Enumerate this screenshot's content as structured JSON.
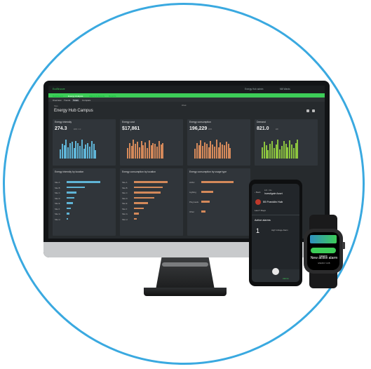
{
  "app": {
    "title": "EcoStruxure",
    "user": "Energy Hub admin",
    "site_selector": "Mill Wards"
  },
  "nav": {
    "tabs": [
      "Dashboard",
      "Energy Analysis",
      "Alarms & Events",
      "Reports"
    ],
    "active_tab": 1,
    "subtabs": [
      "Overview",
      "Trends",
      "Totals",
      "Compare"
    ]
  },
  "page": {
    "breadcrumb": "Sites",
    "title": "Energy Hub Campus",
    "period": "Week"
  },
  "cards": [
    {
      "title": "Energy intensity",
      "value": "274.3",
      "unit": "kWh / m²",
      "bar_color": "#5fb4d6",
      "bars": [
        0.45,
        0.7,
        0.62,
        0.9,
        0.55,
        0.75,
        0.8,
        0.5,
        0.85,
        0.72,
        0.6,
        0.9,
        0.48,
        0.68,
        0.74,
        0.56,
        0.82,
        0.7,
        0.4
      ]
    },
    {
      "title": "Energy cost",
      "value": "$17,861",
      "unit": "",
      "bar_color": "#d4895a",
      "bars": [
        0.5,
        0.75,
        0.6,
        0.9,
        0.7,
        0.8,
        0.55,
        0.85,
        0.65,
        0.78,
        0.5,
        0.88,
        0.62,
        0.74,
        0.7,
        0.58,
        0.82,
        0.66,
        0.72
      ]
    },
    {
      "title": "Energy consumption",
      "value": "196,229",
      "unit": "kWh",
      "bar_color": "#d4895a",
      "bars": [
        0.48,
        0.72,
        0.64,
        0.88,
        0.6,
        0.78,
        0.7,
        0.55,
        0.84,
        0.66,
        0.58,
        0.9,
        0.52,
        0.76,
        0.68,
        0.62,
        0.8,
        0.7,
        0.5
      ]
    },
    {
      "title": "Demand",
      "value": "821.0",
      "unit": "kW",
      "bar_color": "#8cc43f",
      "bars": [
        0.55,
        0.8,
        0.62,
        0.4,
        0.7,
        0.85,
        0.5,
        0.68,
        0.9,
        0.45,
        0.6,
        0.82,
        0.7,
        0.52,
        0.88,
        0.66,
        0.5,
        0.74,
        0.9
      ]
    }
  ],
  "panels": [
    {
      "title": "Energy intensity by location",
      "bar_color": "#5fb4d6",
      "rows": [
        {
          "label": "Site A",
          "value": 1.0
        },
        {
          "label": "Site B",
          "value": 0.55
        },
        {
          "label": "Site C",
          "value": 0.3
        },
        {
          "label": "Site D",
          "value": 0.22
        },
        {
          "label": "Site E",
          "value": 0.18
        },
        {
          "label": "Site F",
          "value": 0.12
        },
        {
          "label": "Site G",
          "value": 0.08
        },
        {
          "label": "Site H",
          "value": 0.05
        }
      ]
    },
    {
      "title": "Energy consumption by location",
      "bar_color": "#d4895a",
      "rows": [
        {
          "label": "Site A",
          "value": 1.0
        },
        {
          "label": "Site B",
          "value": 0.85
        },
        {
          "label": "Site C",
          "value": 0.8
        },
        {
          "label": "Site D",
          "value": 0.6
        },
        {
          "label": "Site E",
          "value": 0.42
        },
        {
          "label": "Site F",
          "value": 0.3
        },
        {
          "label": "Site G",
          "value": 0.15
        },
        {
          "label": "Site H",
          "value": 0.08
        }
      ]
    },
    {
      "title": "Energy consumption by usage type",
      "bar_color": "#d4895a",
      "rows": [
        {
          "label": "HVAC",
          "value": 0.95
        },
        {
          "label": "Lighting",
          "value": 0.35
        },
        {
          "label": "Plug loads",
          "value": 0.25
        },
        {
          "label": "Other",
          "value": 0.12
        }
      ]
    }
  ],
  "phone": {
    "breadcrumb": "EM › Site",
    "title": "Investigate Asset",
    "asset": "55 Franklin Hub",
    "range": "Last 7 Days",
    "alarms_label": "Active alarms",
    "alarm_count": "1",
    "alarm_text": "High Voltage Alarm",
    "tab_label": "Alarms"
  },
  "watch": {
    "button": "Ignore",
    "message": "New active alarm",
    "sub": "ENERGY HUB"
  },
  "colors": {
    "accent_green": "#3dcd58",
    "ring": "#3aa9e0",
    "cyan": "#5fb4d6",
    "orange": "#d4895a",
    "lime": "#8cc43f"
  }
}
